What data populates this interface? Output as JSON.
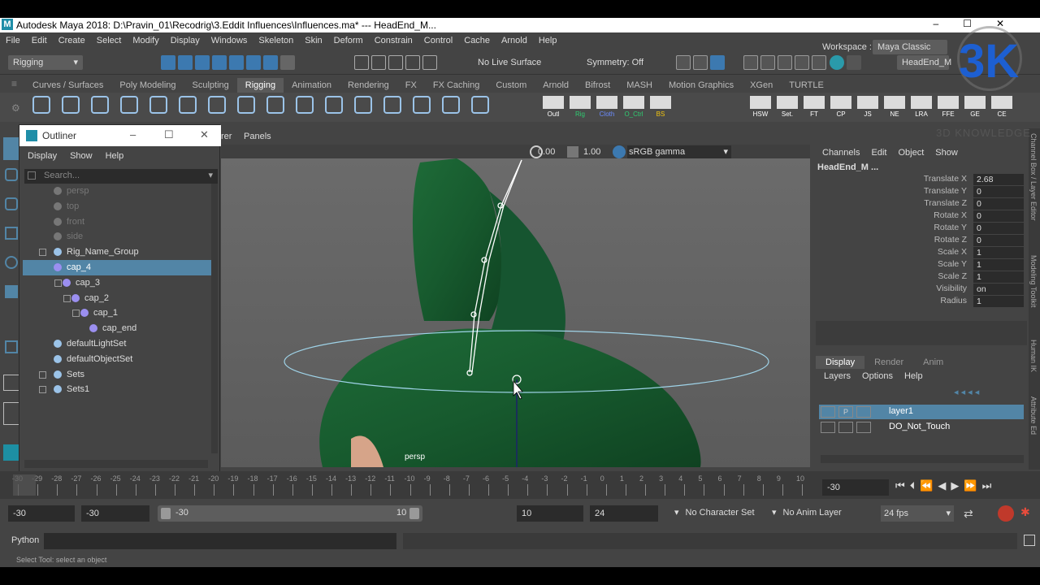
{
  "window": {
    "title": "Autodesk Maya 2018: D:\\Pravin_01\\Recodrig\\3.Eddit Influences\\Influences.ma*  ---  HeadEnd_M...",
    "logo": "M"
  },
  "menubar": [
    "File",
    "Edit",
    "Create",
    "Select",
    "Modify",
    "Display",
    "Windows",
    "Skeleton",
    "Skin",
    "Deform",
    "Constrain",
    "Control",
    "Cache",
    "Arnold",
    "Help"
  ],
  "status": {
    "mode": "Rigging",
    "live_surface": "No Live Surface",
    "symmetry": "Symmetry: Off",
    "object_field": "HeadEnd_M",
    "workspace_label": "Workspace :",
    "workspace_value": "Maya Classic"
  },
  "shelf_tabs": [
    "Curves / Surfaces",
    "Poly Modeling",
    "Sculpting",
    "Rigging",
    "Animation",
    "Rendering",
    "FX",
    "FX Caching",
    "Custom",
    "Arnold",
    "Bifrost",
    "MASH",
    "Motion Graphics",
    "XGen",
    "TURTLE"
  ],
  "shelf_active": "Rigging",
  "shelf_labels": [
    "Outl",
    "Rig",
    "Cloth",
    "O_Ctrl",
    "BS",
    "HSW",
    "Set.",
    "FT",
    "CP",
    "JS",
    "NE",
    "LRA",
    "FFE",
    "GE",
    "CE"
  ],
  "viewport": {
    "menu_a": "rer",
    "menu_b": "Panels",
    "val1": "0.00",
    "val2": "1.00",
    "colorspace": "sRGB gamma",
    "camera_label": "persp"
  },
  "outliner": {
    "title": "Outliner",
    "menu": [
      "Display",
      "Show",
      "Help"
    ],
    "search_placeholder": "Search...",
    "items": [
      {
        "label": "persp",
        "dim": true,
        "indent": 0
      },
      {
        "label": "top",
        "dim": true,
        "indent": 0
      },
      {
        "label": "front",
        "dim": true,
        "indent": 0
      },
      {
        "label": "side",
        "dim": true,
        "indent": 0
      },
      {
        "label": "Rig_Name_Group",
        "dim": false,
        "indent": 0
      },
      {
        "label": "cap_4",
        "dim": false,
        "indent": 0,
        "selected": true
      },
      {
        "label": "cap_3",
        "dim": false,
        "indent": 1
      },
      {
        "label": "cap_2",
        "dim": false,
        "indent": 2
      },
      {
        "label": "cap_1",
        "dim": false,
        "indent": 3
      },
      {
        "label": "cap_end",
        "dim": false,
        "indent": 4
      },
      {
        "label": "defaultLightSet",
        "dim": false,
        "indent": 0
      },
      {
        "label": "defaultObjectSet",
        "dim": false,
        "indent": 0
      },
      {
        "label": "Sets",
        "dim": false,
        "indent": 0
      },
      {
        "label": "Sets1",
        "dim": false,
        "indent": 0
      }
    ]
  },
  "channelbox": {
    "menu": [
      "Channels",
      "Edit",
      "Object",
      "Show"
    ],
    "object": "HeadEnd_M ...",
    "attrs": [
      {
        "name": "Translate X",
        "value": "2.68"
      },
      {
        "name": "Translate Y",
        "value": "0"
      },
      {
        "name": "Translate Z",
        "value": "0"
      },
      {
        "name": "Rotate X",
        "value": "0"
      },
      {
        "name": "Rotate Y",
        "value": "0"
      },
      {
        "name": "Rotate Z",
        "value": "0"
      },
      {
        "name": "Scale X",
        "value": "1"
      },
      {
        "name": "Scale Y",
        "value": "1"
      },
      {
        "name": "Scale Z",
        "value": "1"
      },
      {
        "name": "Visibility",
        "value": "on"
      },
      {
        "name": "Radius",
        "value": "1"
      }
    ],
    "tabs": [
      "Display",
      "Render",
      "Anim"
    ],
    "layer_menu": [
      "Layers",
      "Options",
      "Help"
    ],
    "layers": [
      {
        "name": "layer1",
        "p": "P",
        "selected": true
      },
      {
        "name": "DO_Not_Touch",
        "p": "",
        "selected": false
      }
    ]
  },
  "side_tabs": [
    "Channel Box / Layer Editor",
    "Modeling Toolkit",
    "Human IK",
    "Attribute Ed"
  ],
  "watermark": {
    "big": "3K",
    "text": "3D KNOWLEDGE"
  },
  "timeline": {
    "ticks": [
      "-30",
      "-29",
      "-28",
      "-27",
      "-26",
      "-25",
      "-24",
      "-23",
      "-22",
      "-21",
      "-20",
      "-19",
      "-18",
      "-17",
      "-16",
      "-15",
      "-14",
      "-13",
      "-12",
      "-11",
      "-10",
      "-9",
      "-8",
      "-7",
      "-6",
      "-5",
      "-4",
      "-3",
      "-2",
      "-1",
      "0",
      "1",
      "2",
      "3",
      "4",
      "5",
      "6",
      "7",
      "8",
      "9",
      "10"
    ],
    "current": "-30"
  },
  "range": {
    "start": "-30",
    "start2": "-30",
    "slider_start": "-30",
    "slider_end": "10",
    "end": "10",
    "end2": "24",
    "char_set": "No Character Set",
    "anim_layer": "No Anim Layer",
    "fps": "24 fps"
  },
  "cmdline": {
    "label": "Python"
  },
  "helpline": {
    "text": "Select Tool: select an object"
  },
  "colors": {
    "selected": "#5285a6",
    "cloth": "#1f6b3a"
  }
}
